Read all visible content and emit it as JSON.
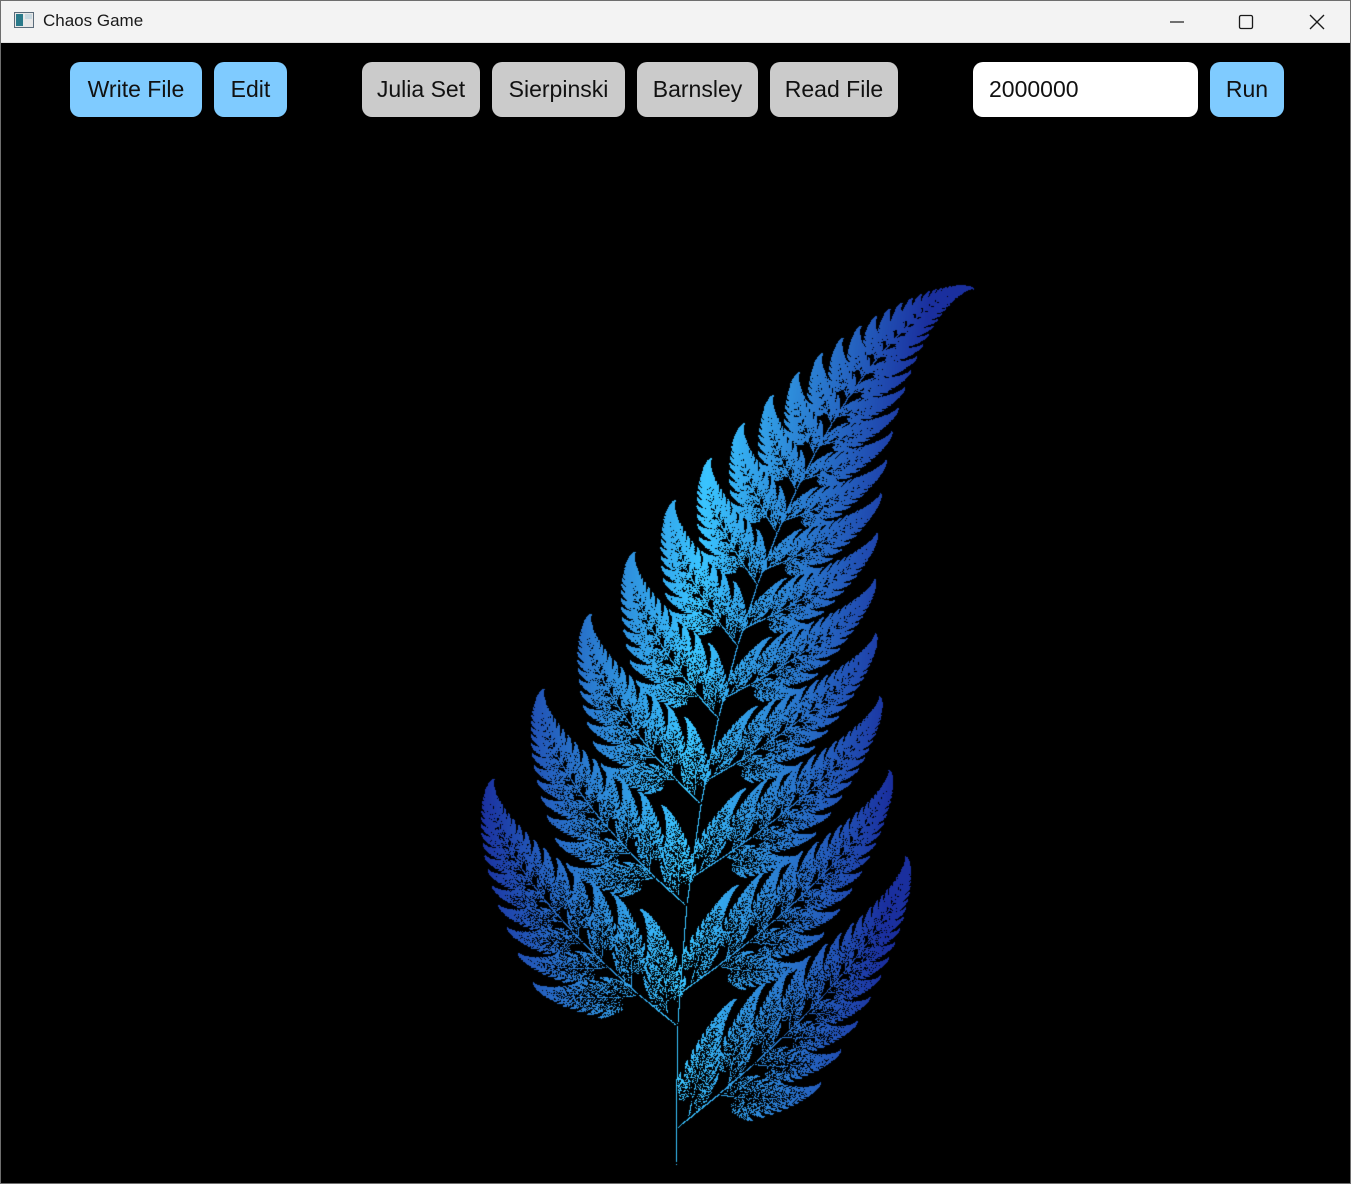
{
  "window": {
    "title": "Chaos Game",
    "controls": [
      "minimize-icon",
      "maximize-icon",
      "close-icon"
    ]
  },
  "toolbar": {
    "write_file_label": "Write File",
    "edit_label": "Edit",
    "julia_set_label": "Julia Set",
    "sierpinski_label": "Sierpinski",
    "barnsley_label": "Barnsley",
    "read_file_label": "Read File",
    "iterations_value": "2000000",
    "run_label": "Run"
  },
  "colors": {
    "accent_button": "#7fcbff",
    "preset_button": "#cbcbcb",
    "background": "#000000",
    "fern_light": "#39c4ff",
    "fern_dark": "#1a2f9e"
  },
  "canvas": {
    "fractal": "Barnsley fern"
  }
}
